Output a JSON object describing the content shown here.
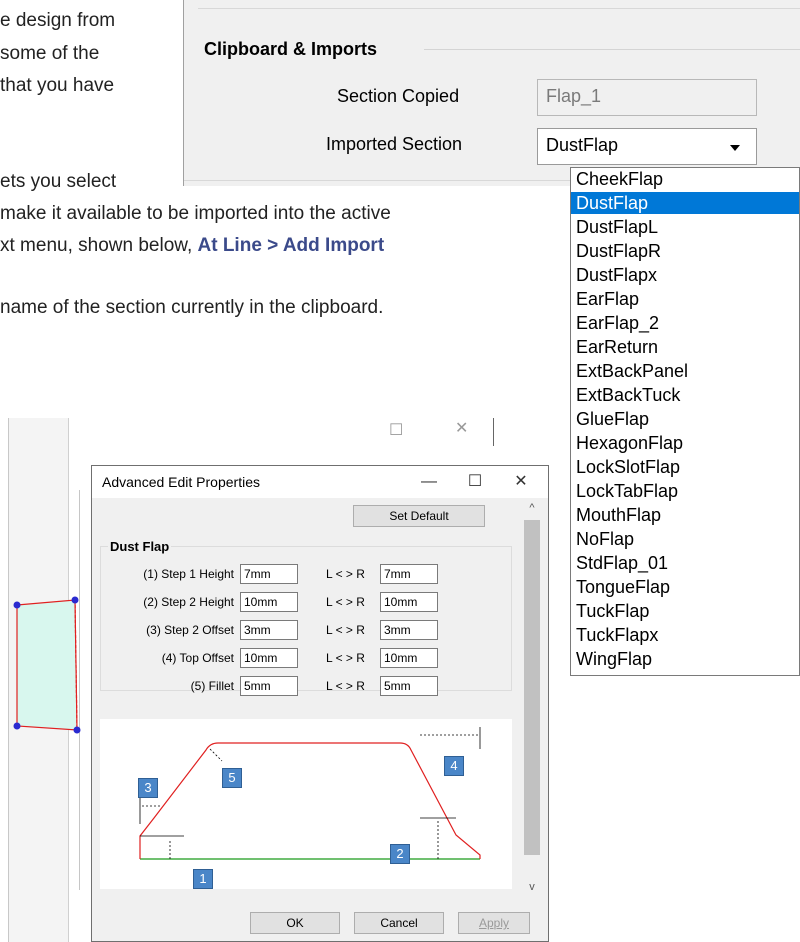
{
  "document": {
    "line1": "e design from",
    "line2": "some of the",
    "line3": "that you have",
    "line4": "ets you select",
    "line5": "make it available to be imported into the active",
    "line6_pre": "xt menu, shown below, ",
    "line6_bold": "At Line > Add Import",
    "line7": "name of the section currently in the clipboard."
  },
  "clipboard_panel": {
    "title": "Clipboard & Imports",
    "section_copied_label": "Section Copied",
    "section_copied_value": "Flap_1",
    "imported_section_label": "Imported Section",
    "imported_section_value": "DustFlap"
  },
  "dropdown": {
    "selected": "DustFlap",
    "options": [
      "CheekFlap",
      "DustFlap",
      "DustFlapL",
      "DustFlapR",
      "DustFlapx",
      "EarFlap",
      "EarFlap_2",
      "EarReturn",
      "ExtBackPanel",
      "ExtBackTuck",
      "GlueFlap",
      "HexagonFlap",
      "LockSlotFlap",
      "LockTabFlap",
      "MouthFlap",
      "NoFlap",
      "StdFlap_01",
      "TongueFlap",
      "TuckFlap",
      "TuckFlapx",
      "WingFlap"
    ]
  },
  "background_window": {
    "minimize": "—",
    "maximize": "☐",
    "close": "✕"
  },
  "dialog": {
    "title": "Advanced Edit Properties",
    "minimize": "—",
    "maximize": "☐",
    "close": "✕",
    "set_default": "Set Default",
    "group_title": "Dust Flap",
    "lr_label": "L < > R",
    "params": [
      {
        "label": "(1) Step 1 Height",
        "left": "7mm",
        "right": "7mm"
      },
      {
        "label": "(2) Step 2 Height",
        "left": "10mm",
        "right": "10mm"
      },
      {
        "label": "(3) Step 2 Offset",
        "left": "3mm",
        "right": "3mm"
      },
      {
        "label": "(4) Top Offset",
        "left": "10mm",
        "right": "10mm"
      },
      {
        "label": "(5) Fillet",
        "left": "5mm",
        "right": "5mm"
      }
    ],
    "badges": [
      "1",
      "2",
      "3",
      "4",
      "5"
    ],
    "ok": "OK",
    "cancel": "Cancel",
    "apply": "Apply",
    "scroll_up": "^",
    "scroll_down": "v"
  },
  "colors": {
    "selection": "#0078d7",
    "badge": "#4a86c8",
    "flap_outline": "#e02020",
    "baseline": "#1a9a1a",
    "flap_fill": "#d8f7ee",
    "handle": "#2a2ad0"
  }
}
